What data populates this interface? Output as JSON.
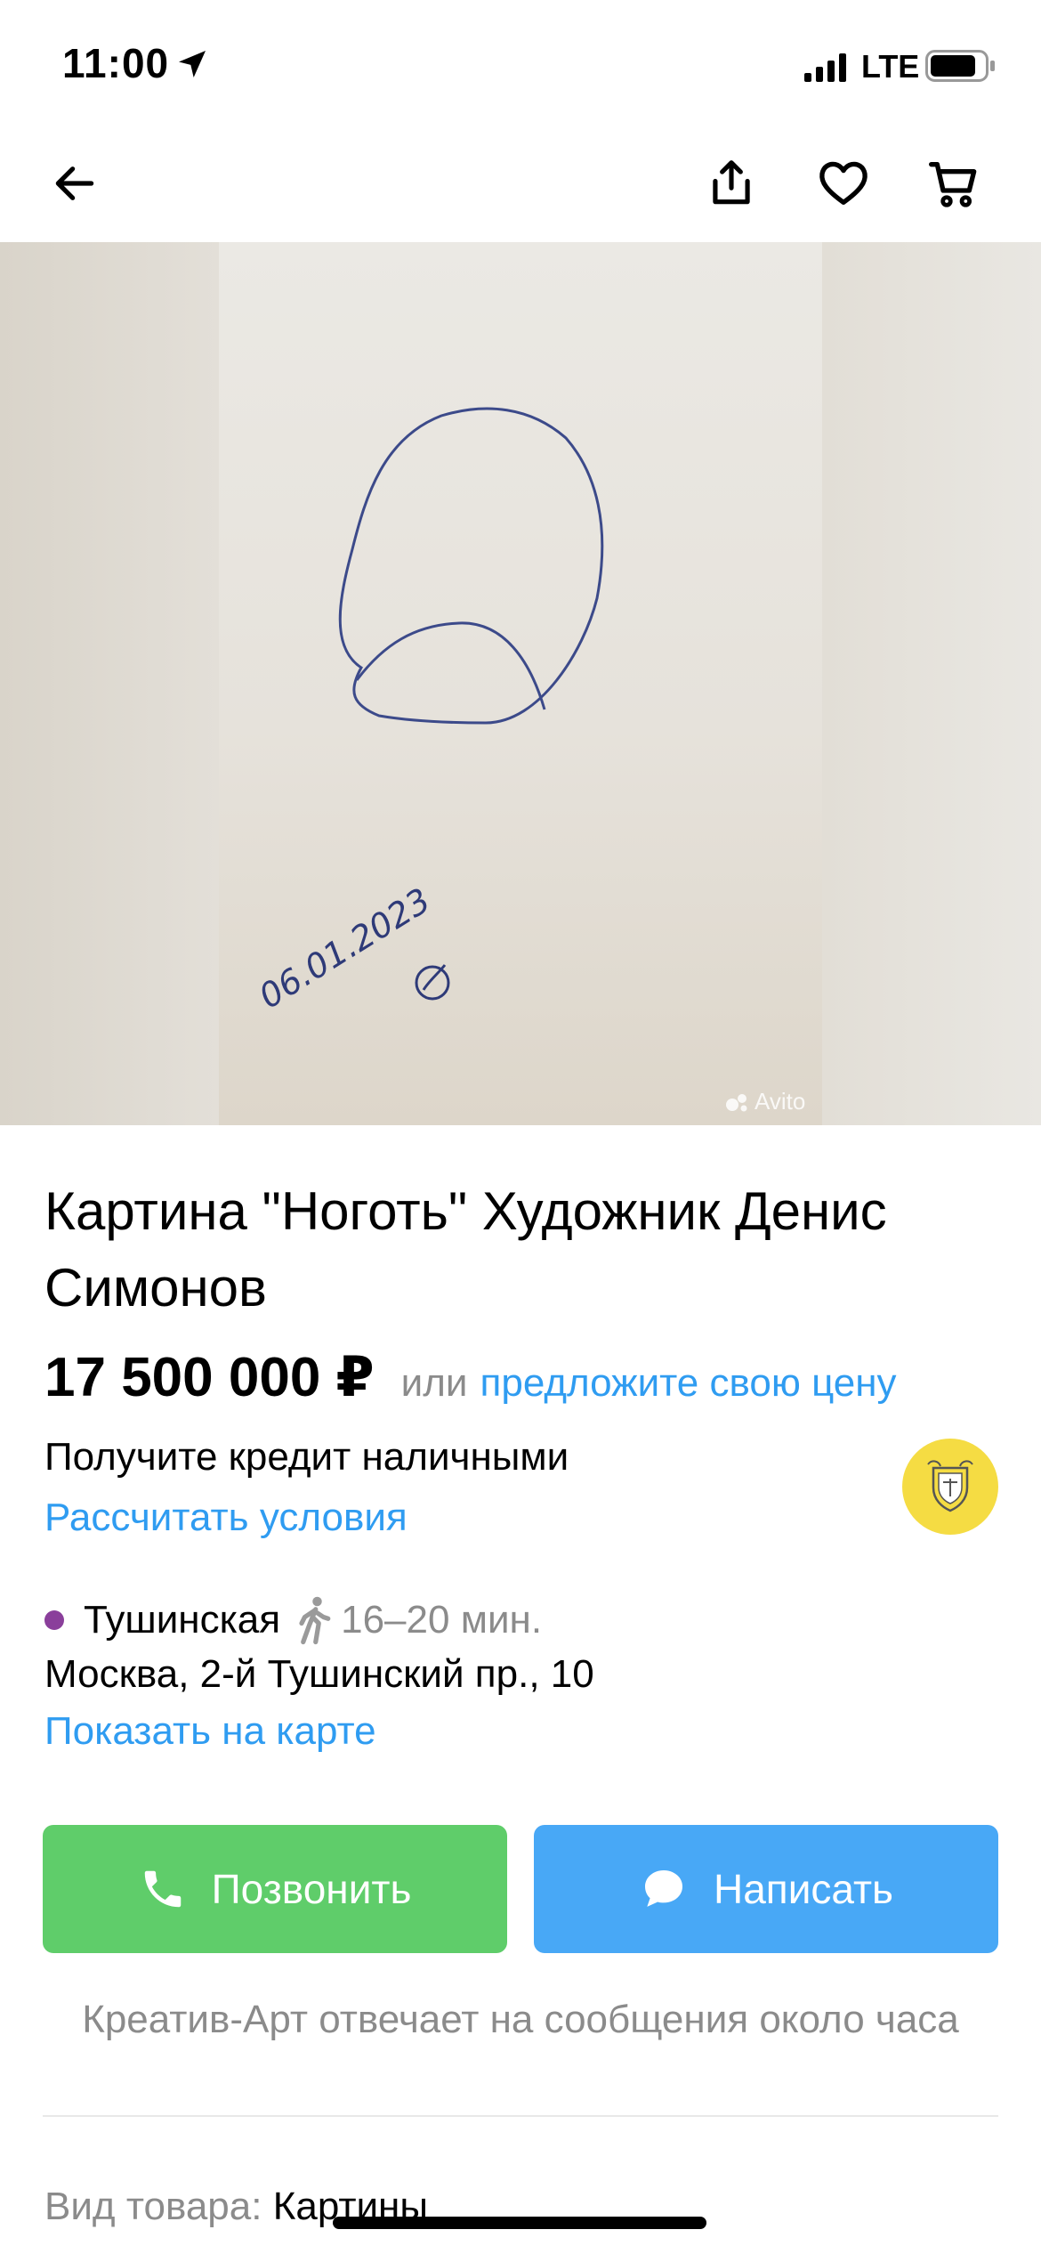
{
  "status_bar": {
    "time": "11:00",
    "network": "LTE",
    "icons": [
      "location-arrow-icon",
      "signal-icon",
      "battery-icon"
    ]
  },
  "nav": {
    "icons": [
      "back-arrow-icon",
      "share-icon",
      "heart-icon",
      "cart-icon"
    ]
  },
  "photo": {
    "handwritten_date": "06.01.2023",
    "watermark": "Avito"
  },
  "listing": {
    "title": "Картина \"Ноготь\" Художник Денис Симонов",
    "price": "17 500 000 ₽",
    "price_or": "или",
    "offer_link": "предложите свою цену"
  },
  "credit": {
    "text": "Получите кредит наличными",
    "link": "Рассчитать условия",
    "logo_icon": "bank-emblem-icon"
  },
  "location": {
    "metro": "Тушинская",
    "metro_color": "#8a3f9b",
    "walk_time": "16–20 мин.",
    "address": "Москва, 2-й Тушинский пр., 10",
    "map_link": "Показать на карте"
  },
  "actions": {
    "call_label": "Позвонить",
    "write_label": "Написать",
    "call_color": "#5fcd6a",
    "write_color": "#48a8f6"
  },
  "seller": {
    "reply_note": "Креатив-Арт отвечает на сообщения около часа"
  },
  "params": {
    "label": "Вид товара:",
    "value": "Картины"
  },
  "colors": {
    "link": "#2f9cf1",
    "muted": "#8b8b8b"
  }
}
